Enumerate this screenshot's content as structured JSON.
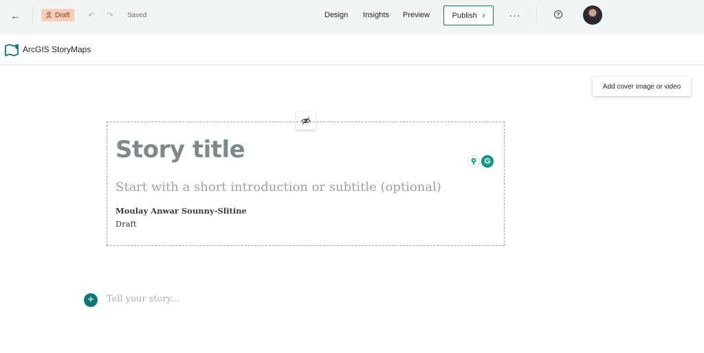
{
  "topbar": {
    "back_icon": "arrow-left-icon",
    "status_badge": "Draft",
    "saved_label": "Saved",
    "nav": {
      "design": "Design",
      "insights": "Insights",
      "preview": "Preview"
    },
    "publish_label": "Publish",
    "more_icon": "ellipsis-icon",
    "help_icon": "question-circle-icon",
    "accent_color": "#0b7877",
    "badge_color": "#f7cdb7"
  },
  "brand": {
    "name": "ArcGIS StoryMaps"
  },
  "cover": {
    "add_label": "Add cover image or video"
  },
  "story": {
    "title_placeholder": "Story title",
    "subtitle_placeholder": "Start with a short introduction or subtitle (optional)",
    "author": "Moulay Anwar Sounny-Slitine",
    "status": "Draft",
    "body_placeholder": "Tell your story..."
  }
}
